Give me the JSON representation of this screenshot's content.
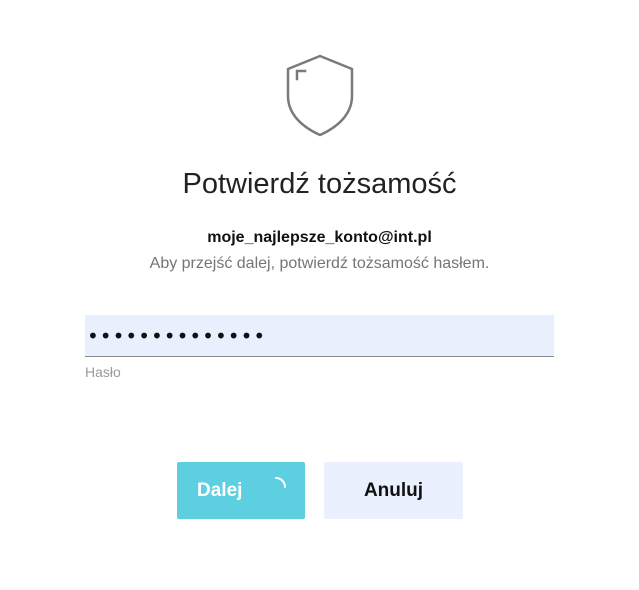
{
  "dialog": {
    "title": "Potwierdź tożsamość",
    "account_email": "moje_najlepsze_konto@int.pl",
    "instruction": "Aby przejść dalej, potwierdź tożsamość hasłem."
  },
  "password_field": {
    "value": "••••••••••••••",
    "label": "Hasło"
  },
  "buttons": {
    "next_label": "Dalej",
    "cancel_label": "Anuluj"
  },
  "colors": {
    "next_button": "#5ecfe0",
    "cancel_button": "#eaf0fd",
    "input_background": "#e8f0fe",
    "shield_stroke": "#7a7a7a"
  },
  "icons": {
    "header": "shield-icon",
    "loading": "spinner-icon"
  }
}
